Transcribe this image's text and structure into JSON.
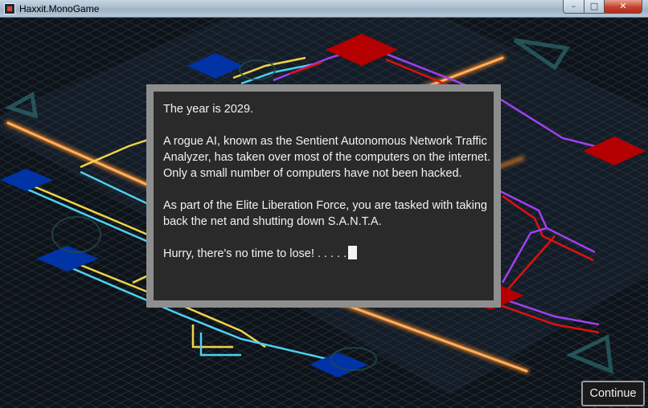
{
  "window": {
    "title": "Haxxit.MonoGame",
    "minimize_glyph": "–",
    "maximize_glyph": "□",
    "close_glyph": "✕"
  },
  "dialog": {
    "line1": "The year is 2029.",
    "line2": "A rogue AI, known as the Sentient Autonomous Network Traffic Analyzer, has taken over most of the computers on the internet. Only a small number of computers have not been hacked.",
    "line3": "As part of the Elite Liberation Force, you are tasked with taking back the net and shutting down S.A.N.T.A.",
    "line4": "Hurry, there's no time to lose! . . . . ."
  },
  "continue_button": {
    "label": "Continue"
  },
  "colors": {
    "player_node": "#0033a6",
    "enemy_node": "#b40000",
    "yellow_link": "#f3d349",
    "cyan_link": "#4fd0f0",
    "violet_link": "#a040f0",
    "red_link": "#e01010",
    "orange_data": "#ff9a30"
  }
}
